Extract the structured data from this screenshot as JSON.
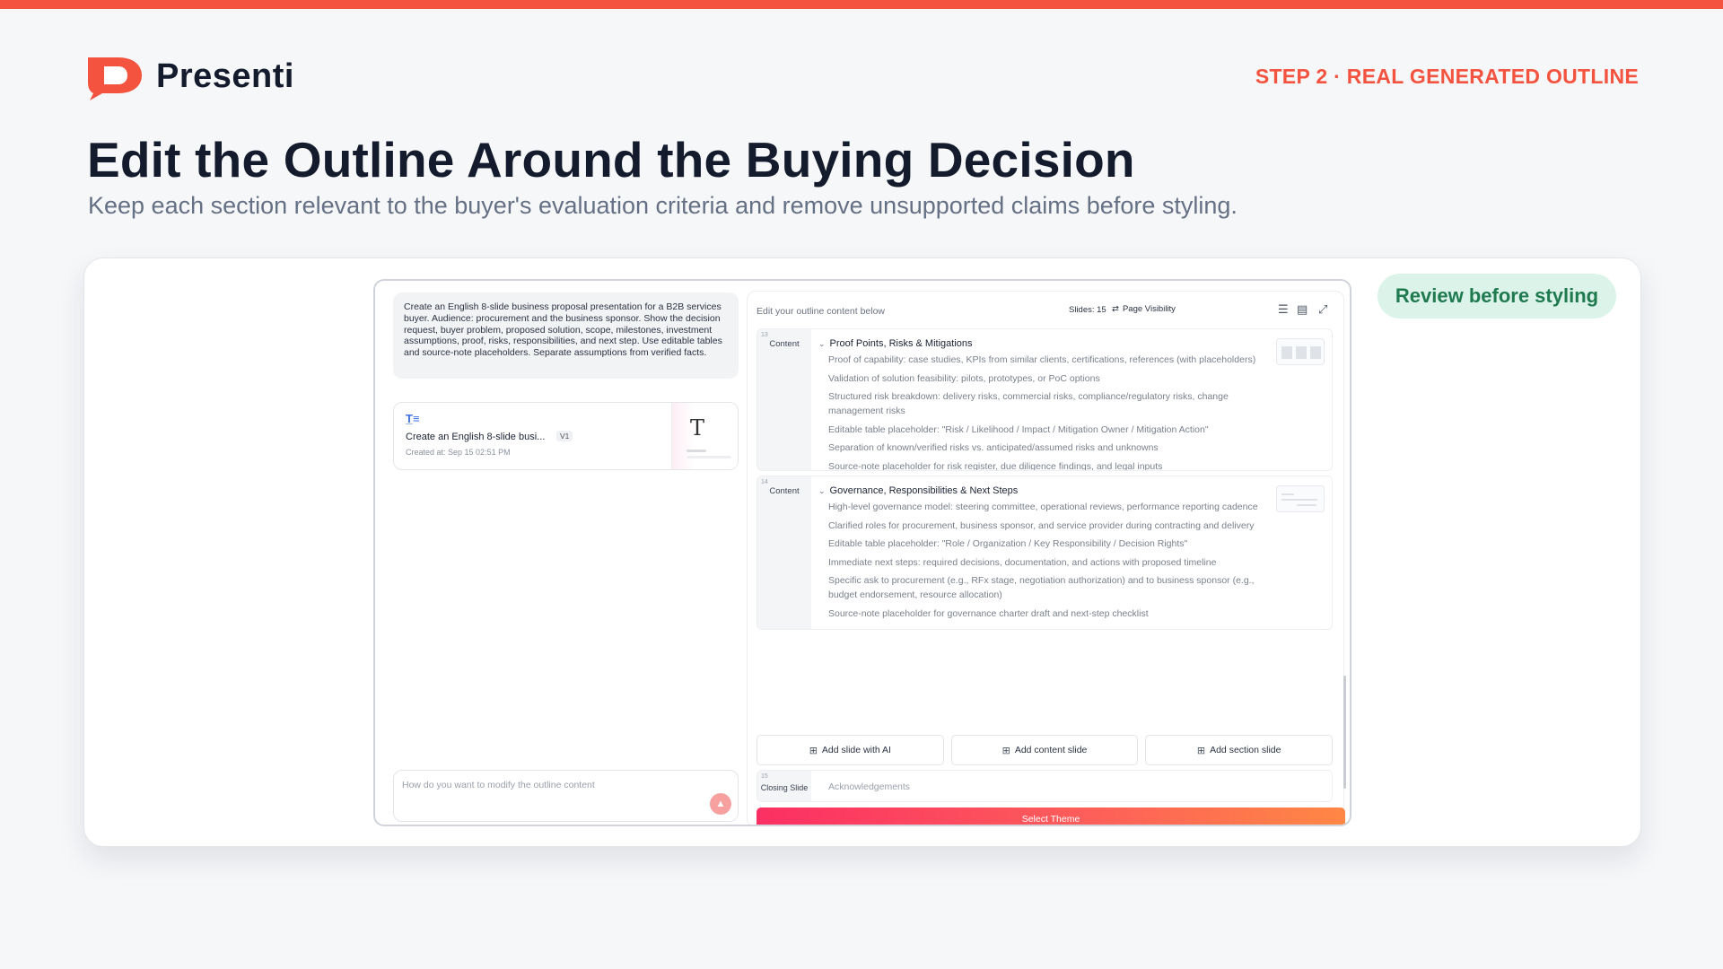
{
  "brand": {
    "name": "Presenti",
    "color": "#f4533f"
  },
  "step_label": "STEP 2 · REAL GENERATED OUTLINE",
  "title": "Edit the Outline Around the Buying Decision",
  "subtitle": "Keep each section relevant to the buyer's evaluation criteria and remove unsupported claims before styling.",
  "review_pill": "Review before styling",
  "app": {
    "prompt": "Create an English 8-slide business proposal presentation for a B2B services buyer. Audience: procurement and the business sponsor. Show the decision request, buyer problem, proposed solution, scope, milestones, investment assumptions, proof, risks, responsibilities, and next step. Use editable tables and source-note placeholders. Separate assumptions from verified facts.",
    "history": {
      "title": "Create an English 8-slide busi...",
      "version": "V1",
      "created": "Created at: Sep 15 02:51 PM",
      "thumb_glyph": "T"
    },
    "modify_placeholder": "How do you want to modify the outline content",
    "outline": {
      "header_label": "Edit your outline content below",
      "slides_count": "Slides: 15",
      "page_visibility": "Page Visibility",
      "slides": [
        {
          "number": "13",
          "type": "Content",
          "heading": "Proof Points, Risks & Mitigations",
          "bullets": [
            "Proof of capability: case studies, KPIs from similar clients, certifications, references (with placeholders)",
            "Validation of solution feasibility: pilots, prototypes, or PoC options",
            "Structured risk breakdown: delivery risks, commercial risks, compliance/regulatory risks, change management risks",
            "Editable table placeholder: \"Risk / Likelihood / Impact / Mitigation Owner / Mitigation Action\"",
            "Separation of known/verified risks vs. anticipated/assumed risks and unknowns",
            "Source-note placeholder for risk register, due diligence findings, and legal inputs"
          ]
        },
        {
          "number": "14",
          "type": "Content",
          "heading": "Governance, Responsibilities & Next Steps",
          "bullets": [
            "High-level governance model: steering committee, operational reviews, performance reporting cadence",
            "Clarified roles for procurement, business sponsor, and service provider during contracting and delivery",
            "Editable table placeholder: \"Role / Organization / Key Responsibility / Decision Rights\"",
            "Immediate next steps: required decisions, documentation, and actions with proposed timeline",
            "Specific ask to procurement (e.g., RFx stage, negotiation authorization) and to business sponsor (e.g., budget endorsement, resource allocation)",
            "Source-note placeholder for governance charter draft and next-step checklist"
          ]
        }
      ],
      "add_buttons": [
        "Add slide with AI",
        "Add content slide",
        "Add section slide"
      ],
      "closing": {
        "number": "15",
        "type": "Closing Slide",
        "text": "Acknowledgements"
      },
      "select_theme": "Select Theme"
    }
  }
}
